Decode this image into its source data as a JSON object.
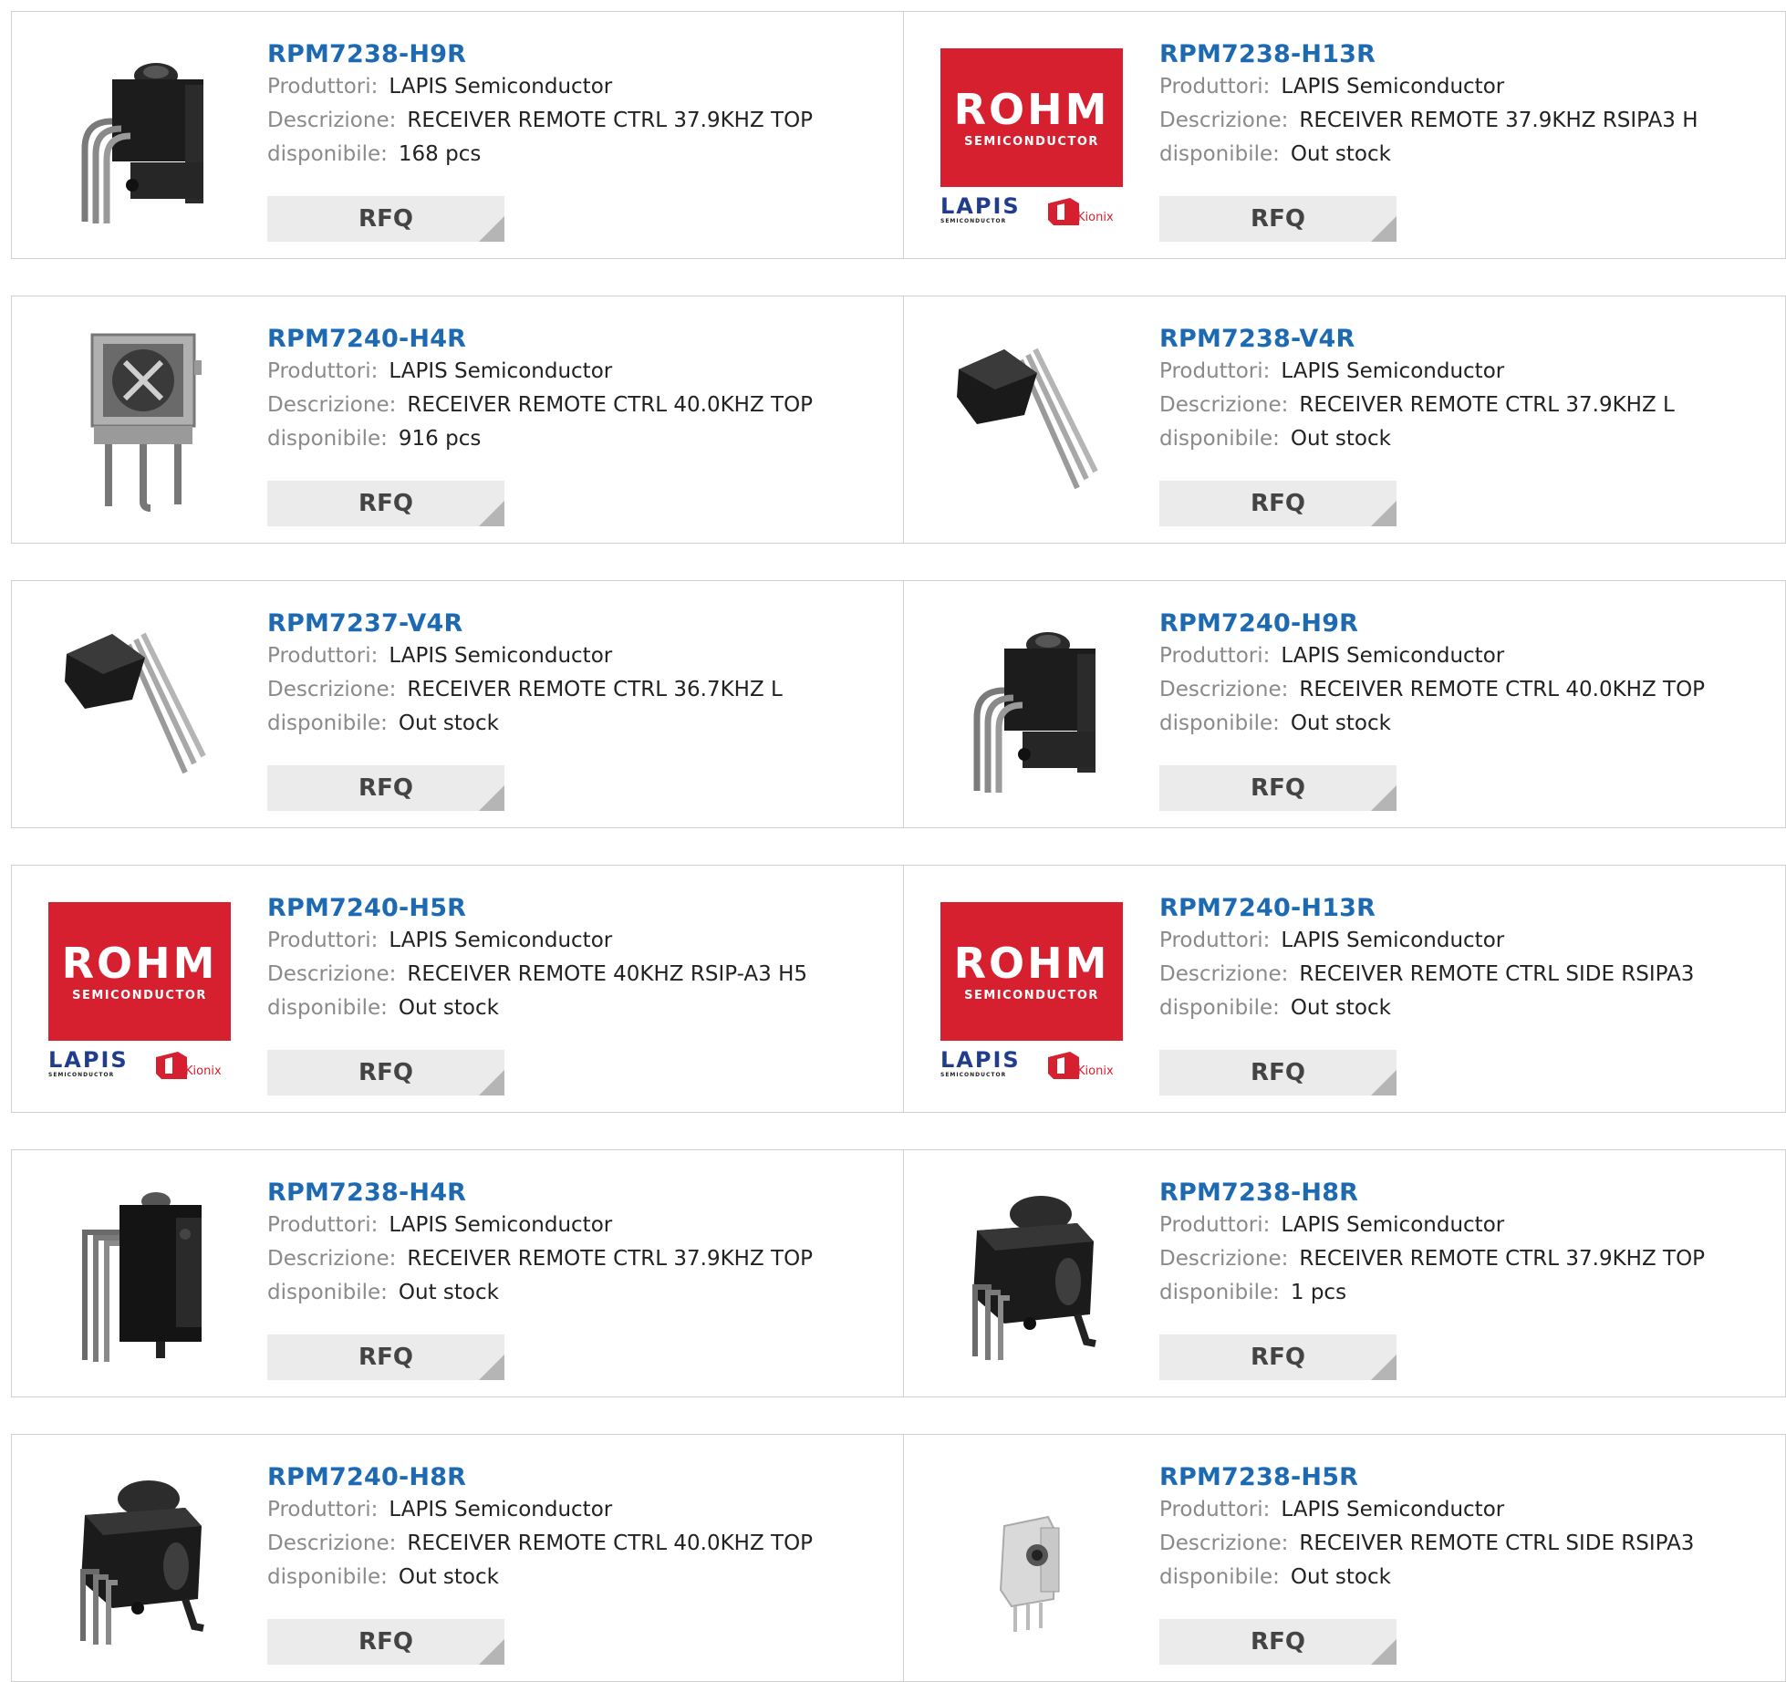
{
  "labels": {
    "manufacturer": "Produttori:",
    "description": "Descrizione:",
    "available": "disponibile:",
    "rfq": "RFQ"
  },
  "products": [
    {
      "part": "RPM7238-H9R",
      "manufacturer": "LAPIS Semiconductor",
      "description": "RECEIVER REMOTE CTRL 37.9KHZ TOP",
      "available": "168 pcs",
      "image": "ir-receiver-top-photo"
    },
    {
      "part": "RPM7238-H13R",
      "manufacturer": "LAPIS Semiconductor",
      "description": "RECEIVER REMOTE 37.9KHZ RSIPA3 H",
      "available": "Out stock",
      "image": "rohm-lapis-logo"
    },
    {
      "part": "RPM7240-H4R",
      "manufacturer": "LAPIS Semiconductor",
      "description": "RECEIVER REMOTE CTRL 40.0KHZ TOP",
      "available": "916 pcs",
      "image": "ir-receiver-front-photo"
    },
    {
      "part": "RPM7238-V4R",
      "manufacturer": "LAPIS Semiconductor",
      "description": "RECEIVER REMOTE CTRL 37.9KHZ L",
      "available": "Out stock",
      "image": "ir-receiver-side-photo"
    },
    {
      "part": "RPM7237-V4R",
      "manufacturer": "LAPIS Semiconductor",
      "description": "RECEIVER REMOTE CTRL 36.7KHZ L",
      "available": "Out stock",
      "image": "ir-receiver-side-photo"
    },
    {
      "part": "RPM7240-H9R",
      "manufacturer": "LAPIS Semiconductor",
      "description": "RECEIVER REMOTE CTRL 40.0KHZ TOP",
      "available": "Out stock",
      "image": "ir-receiver-top-photo"
    },
    {
      "part": "RPM7240-H5R",
      "manufacturer": "LAPIS Semiconductor",
      "description": "RECEIVER REMOTE 40KHZ RSIP-A3 H5",
      "available": "Out stock",
      "image": "rohm-lapis-logo"
    },
    {
      "part": "RPM7240-H13R",
      "manufacturer": "LAPIS Semiconductor",
      "description": "RECEIVER REMOTE CTRL SIDE RSIPA3",
      "available": "Out stock",
      "image": "rohm-lapis-logo"
    },
    {
      "part": "RPM7238-H4R",
      "manufacturer": "LAPIS Semiconductor",
      "description": "RECEIVER REMOTE CTRL 37.9KHZ TOP",
      "available": "Out stock",
      "image": "ir-receiver-back-photo"
    },
    {
      "part": "RPM7238-H8R",
      "manufacturer": "LAPIS Semiconductor",
      "description": "RECEIVER REMOTE CTRL 37.9KHZ TOP",
      "available": "1 pcs",
      "image": "ir-receiver-box-photo"
    },
    {
      "part": "RPM7240-H8R",
      "manufacturer": "LAPIS Semiconductor",
      "description": "RECEIVER REMOTE CTRL 40.0KHZ TOP",
      "available": "Out stock",
      "image": "ir-receiver-box-photo"
    },
    {
      "part": "RPM7238-H5R",
      "manufacturer": "LAPIS Semiconductor",
      "description": "RECEIVER REMOTE CTRL SIDE RSIPA3",
      "available": "Out stock",
      "image": "ir-receiver-silver-photo"
    }
  ],
  "logo": {
    "brand": "ROHM",
    "sub": "SEMICONDUCTOR",
    "lapis": "LAPIS",
    "lapis_sub": "SEMICONDUCTOR",
    "kionix": "Kionix"
  },
  "colors": {
    "link": "#1d6ab3",
    "rohm_red": "#d7202f",
    "lapis_blue": "#1f3d8a",
    "button_bg": "#ebebeb"
  }
}
